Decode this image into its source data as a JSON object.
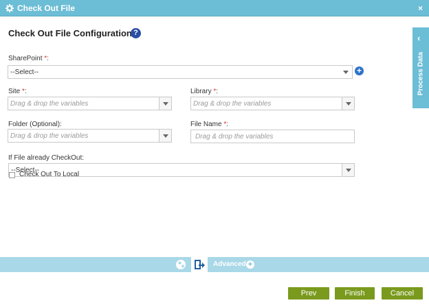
{
  "window": {
    "title": "Check Out File",
    "close_label": "×"
  },
  "heading": {
    "title": "Check Out File Configuration",
    "help_label": "?"
  },
  "form": {
    "sharepoint": {
      "label": "SharePoint ",
      "required_mark": "*",
      "colon": ":",
      "value": "--Select--"
    },
    "site": {
      "label": "Site ",
      "required_mark": "*",
      "colon": ":",
      "placeholder": "Drag & drop the variables"
    },
    "library": {
      "label": "Library ",
      "required_mark": "*",
      "colon": ":",
      "placeholder": "Drag & drop the variables"
    },
    "folder": {
      "label": "Folder (Optional):",
      "placeholder": "Drag & drop the variables"
    },
    "file_name": {
      "label": "File Name ",
      "required_mark": "*",
      "colon": ":",
      "placeholder": "Drag & drop the variables"
    },
    "if_checked_out": {
      "label": "If File already CheckOut:",
      "value": "--Select--"
    },
    "check_out_to_local": {
      "label": "Check Out To Local",
      "checked": false
    }
  },
  "side_panel": {
    "label": "Process Data",
    "chevron": "‹"
  },
  "bottom_bar": {
    "advanced_label": "Advanced",
    "advanced_plus": "+"
  },
  "buttons": {
    "prev": "Prev",
    "finish": "Finish",
    "cancel": "Cancel"
  },
  "colors": {
    "accent": "#6cbdd6",
    "button": "#7a9a1e",
    "required": "#d9342b",
    "help": "#2b4ea3"
  }
}
